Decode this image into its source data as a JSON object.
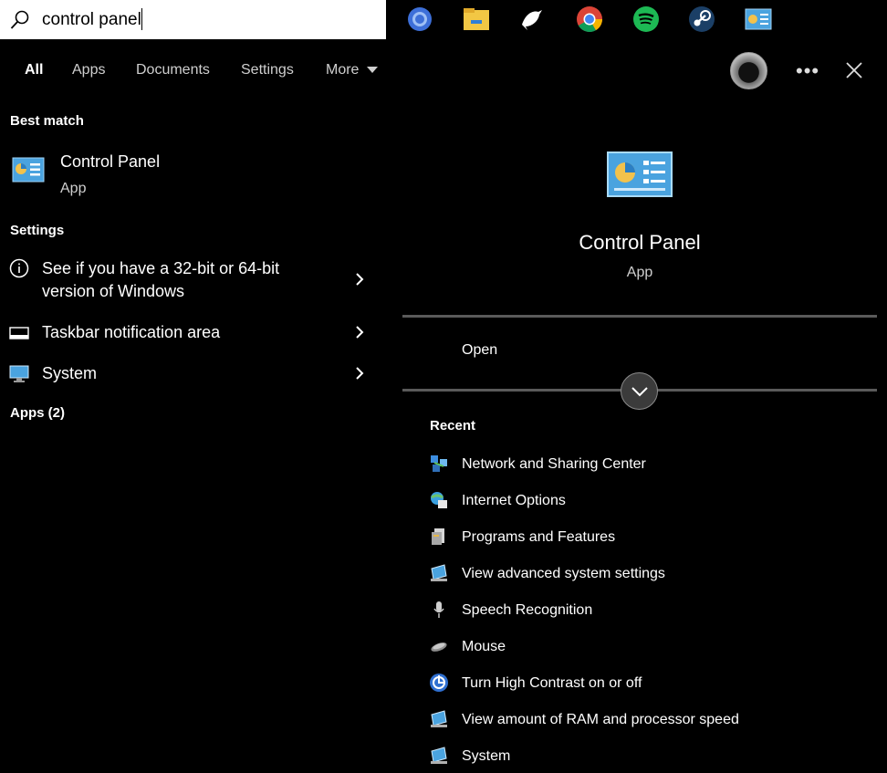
{
  "search": {
    "query": "control panel"
  },
  "tabs": [
    "All",
    "Apps",
    "Documents",
    "Settings",
    "More"
  ],
  "taskbar_icons": [
    "browser-icon",
    "file-explorer-icon",
    "bird-app-icon",
    "chrome-icon",
    "spotify-icon",
    "steam-icon",
    "control-panel-icon"
  ],
  "best_match": {
    "heading": "Best match",
    "title": "Control Panel",
    "subtitle": "App"
  },
  "settings": {
    "heading": "Settings",
    "items": [
      {
        "label": "See if you have a 32-bit or 64-bit version of Windows",
        "icon": "info-icon"
      },
      {
        "label": "Taskbar notification area",
        "icon": "taskbar-icon"
      },
      {
        "label": "System",
        "icon": "monitor-icon"
      }
    ]
  },
  "apps_heading": "Apps (2)",
  "preview": {
    "title": "Control Panel",
    "subtitle": "App",
    "open_label": "Open",
    "recent_heading": "Recent",
    "recent": [
      {
        "label": "Network and Sharing Center",
        "icon": "network-icon"
      },
      {
        "label": "Internet Options",
        "icon": "internet-options-icon"
      },
      {
        "label": "Programs and Features",
        "icon": "programs-icon"
      },
      {
        "label": "View advanced system settings",
        "icon": "system-settings-icon"
      },
      {
        "label": "Speech Recognition",
        "icon": "microphone-icon"
      },
      {
        "label": "Mouse",
        "icon": "mouse-icon"
      },
      {
        "label": "Turn High Contrast on or off",
        "icon": "ease-of-access-icon"
      },
      {
        "label": "View amount of RAM and processor speed",
        "icon": "system-icon"
      },
      {
        "label": "System",
        "icon": "system-icon"
      }
    ]
  },
  "colors": {
    "background": "#000000",
    "accent": "#4aa3df",
    "divider": "#5a5a5a"
  }
}
